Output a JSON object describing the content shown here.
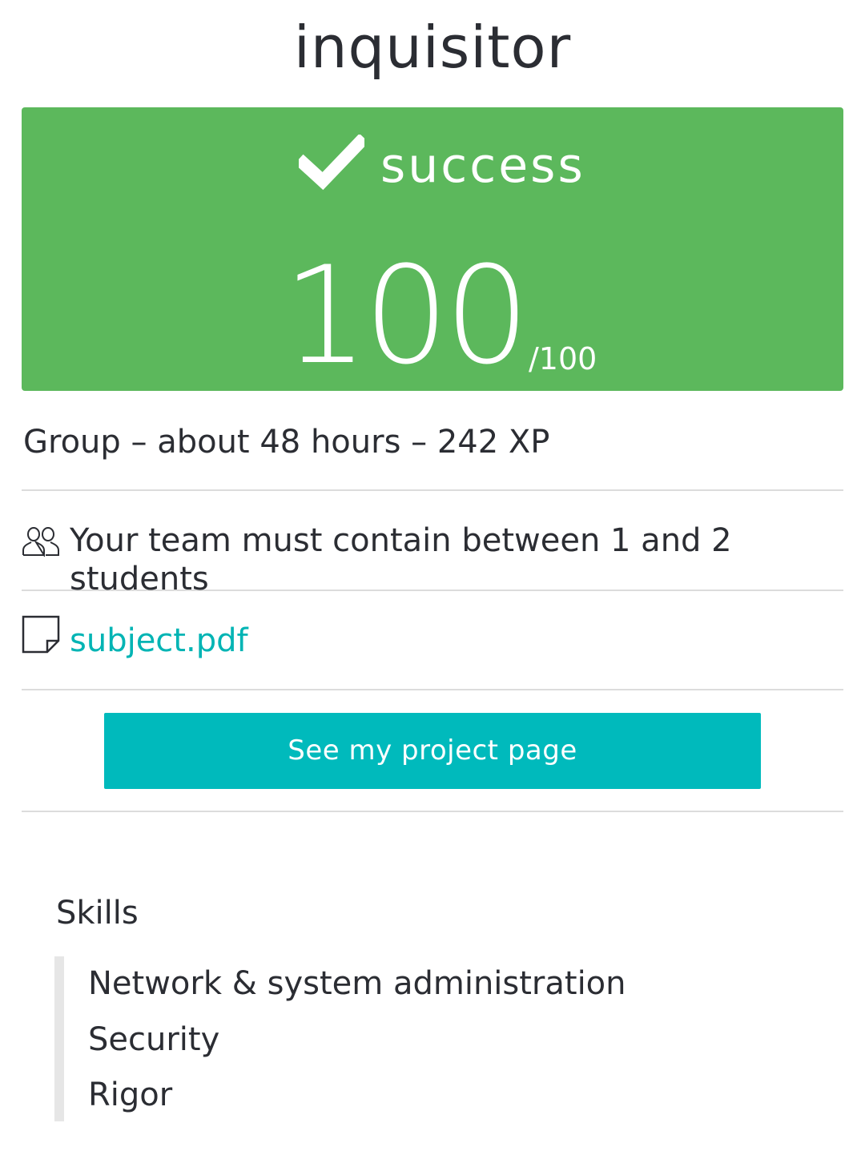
{
  "project": {
    "title": "inquisitor"
  },
  "result": {
    "status": "success",
    "score": "100",
    "score_max": "/100",
    "success_color": "#5cb85c",
    "status_icon": "check-icon"
  },
  "meta": {
    "text": "Group – about 48 hours – 242 XP"
  },
  "team": {
    "icon": "users-icon",
    "text": "Your team must contain between 1 and 2 students"
  },
  "subject": {
    "icon": "file-icon",
    "label": "subject.pdf",
    "link_color": "#00b4b4"
  },
  "actions": {
    "project_page_label": "See my project page",
    "button_color": "#00babc"
  },
  "skills": {
    "title": "Skills",
    "items": [
      "Network & system administration",
      "Security",
      "Rigor"
    ]
  }
}
